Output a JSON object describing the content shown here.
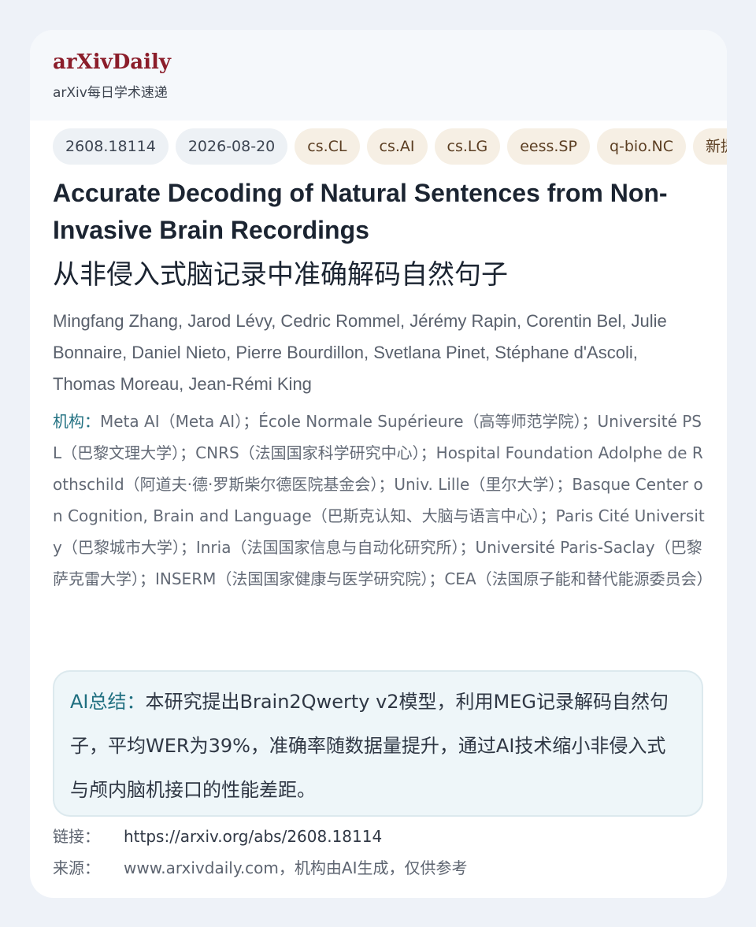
{
  "brand": {
    "title": "arXivDaily",
    "subtitle": "arXiv每日学术速递"
  },
  "tags": [
    {
      "kind": "id",
      "label": "2608.18114"
    },
    {
      "kind": "date",
      "label": "2026-08-20"
    },
    {
      "kind": "cat",
      "label": "cs.CL"
    },
    {
      "kind": "cat",
      "label": "cs.AI"
    },
    {
      "kind": "cat",
      "label": "cs.LG"
    },
    {
      "kind": "cat",
      "label": "eess.SP"
    },
    {
      "kind": "cat",
      "label": "q-bio.NC"
    },
    {
      "kind": "cat",
      "label": "新提"
    }
  ],
  "paper": {
    "title_en": "Accurate Decoding of Natural Sentences from Non-Invasive Brain Recordings",
    "title_zh": "从非侵入式脑记录中准确解码自然句子",
    "authors": "Mingfang Zhang, Jarod Lévy, Cedric Rommel, Jérémy Rapin, Corentin Bel, Julie Bonnaire, Daniel Nieto, Pierre Bourdillon, Svetlana Pinet, Stéphane d'Ascoli, Thomas Moreau, Jean-Rémi King",
    "affiliations_label": "机构：",
    "affiliations": "Meta AI（Meta AI）；École Normale Supérieure（高等师范学院）；Université PSL（巴黎文理大学）；CNRS（法国国家科学研究中心）；Hospital Foundation Adolphe de Rothschild（阿道夫·德·罗斯柴尔德医院基金会）；Univ. Lille（里尔大学）；Basque Center on Cognition, Brain and Language（巴斯克认知、大脑与语言中心）；Paris Cité University（巴黎城市大学）；Inria（法国国家信息与自动化研究所）；Université Paris-Saclay（巴黎萨克雷大学）；INSERM（法国国家健康与医学研究院）；CEA（法国原子能和替代能源委员会）"
  },
  "summary": {
    "label": "AI总结：",
    "text": "本研究提出Brain2Qwerty v2模型，利用MEG记录解码自然句子，平均WER为39%，准确率随数据量提升，通过AI技术缩小非侵入式与颅内脑机接口的性能差距。"
  },
  "meta": {
    "link_label": "链接：",
    "link_value": "https://arxiv.org/abs/2608.18114",
    "source_label": "来源：",
    "source_value": "www.arxivdaily.com，机构由AI生成，仅供参考"
  }
}
